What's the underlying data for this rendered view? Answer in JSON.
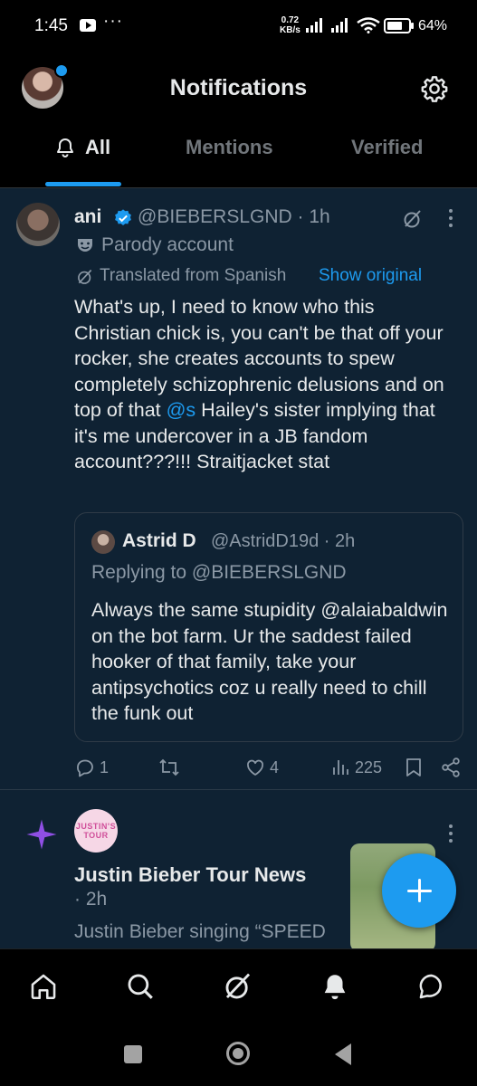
{
  "status_bar": {
    "time": "1:45",
    "dots": "···",
    "speed_value": "0.72",
    "speed_unit": "KB/s",
    "battery": "64%"
  },
  "header": {
    "title": "Notifications",
    "tabs": [
      {
        "label": "All",
        "active": true
      },
      {
        "label": "Mentions",
        "active": false
      },
      {
        "label": "Verified",
        "active": false
      }
    ]
  },
  "post1": {
    "name": "ani",
    "handle": "@BIEBERSLGND · 1h",
    "parody_label": "Parody account",
    "translated_label": "Translated from Spanish",
    "show_original": "Show original",
    "body_before": "What's up, I need to know who this Christian chick is, you can't be that off your rocker, she creates accounts to spew completely schizophrenic delusions and on top of that ",
    "mention": "@s",
    "body_after": " Hailey's sister implying that it's me undercover in a JB fandom account???!!! Straitjacket stat",
    "quote": {
      "name": "Astrid D",
      "handle": "@AstridD19d · 2h",
      "replying_to": "Replying to @BIEBERSLGND",
      "body": "Always the same stupidity @alaiabaldwin on the bot farm. Ur the saddest failed hooker of that family, take your antipsychotics coz u really need to chill the funk out"
    },
    "actions": {
      "replies": "1",
      "likes": "4",
      "views": "225"
    }
  },
  "post2": {
    "avatar_text": "JUSTIN'S TOUR",
    "title": "Justin Bieber Tour News",
    "time": "· 2h",
    "text": "Justin Bieber singing “SPEED DEMON” at"
  },
  "icons": {
    "settings": "gear-icon",
    "bell": "bell-icon",
    "grok": "grok-icon",
    "more": "more-vertical-icon",
    "compose": "plus-icon",
    "nav": [
      "home-icon",
      "search-icon",
      "grok-icon",
      "bell-icon",
      "messages-icon"
    ]
  },
  "colors": {
    "accent": "#1d9bf0",
    "background": "#000000",
    "feed_background": "#0f2233"
  }
}
